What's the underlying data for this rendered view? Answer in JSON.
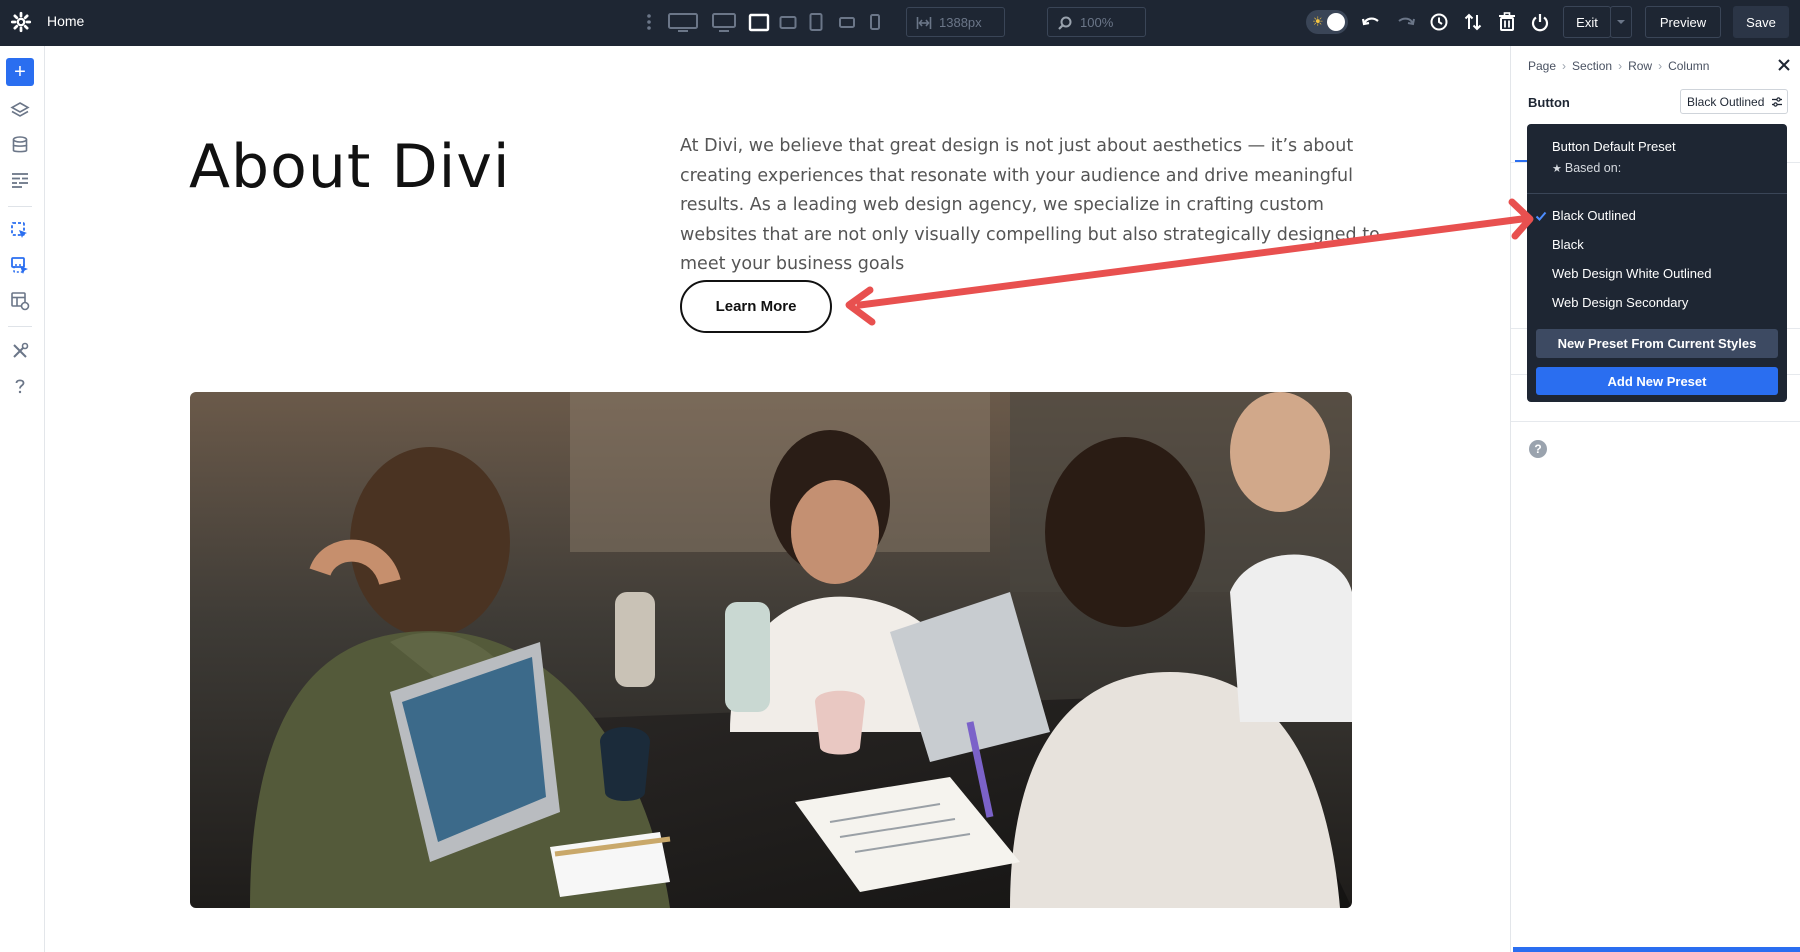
{
  "topbar": {
    "title": "Home",
    "width_value": "1388px",
    "zoom_value": "100%",
    "exit_label": "Exit",
    "preview_label": "Preview",
    "save_label": "Save"
  },
  "content": {
    "heading": "About Divi",
    "paragraph": "At Divi, we believe that great design is not just about aesthetics — it’s about creating experiences that resonate with your audience and drive meaningful results. As a leading web design agency, we specialize in crafting custom websites that are not only visually compelling but also strategically designed to meet your business goals",
    "button_label": "Learn More"
  },
  "panel": {
    "breadcrumbs": [
      "Page",
      "Section",
      "Row",
      "Column"
    ],
    "title": "Button",
    "preset_selected": "Black Outlined"
  },
  "preset_dropdown": {
    "default_label": "Button Default Preset",
    "based_on_label": "Based on:",
    "items": [
      "Black Outlined",
      "Black",
      "Web Design White Outlined",
      "Web Design Secondary"
    ],
    "selected_index": 0,
    "new_from_styles_label": "New Preset From Current Styles",
    "add_new_label": "Add New Preset"
  },
  "colors": {
    "topbar_bg": "#1e2633",
    "accent": "#2a6ef0",
    "arrow": "#e8504f"
  }
}
